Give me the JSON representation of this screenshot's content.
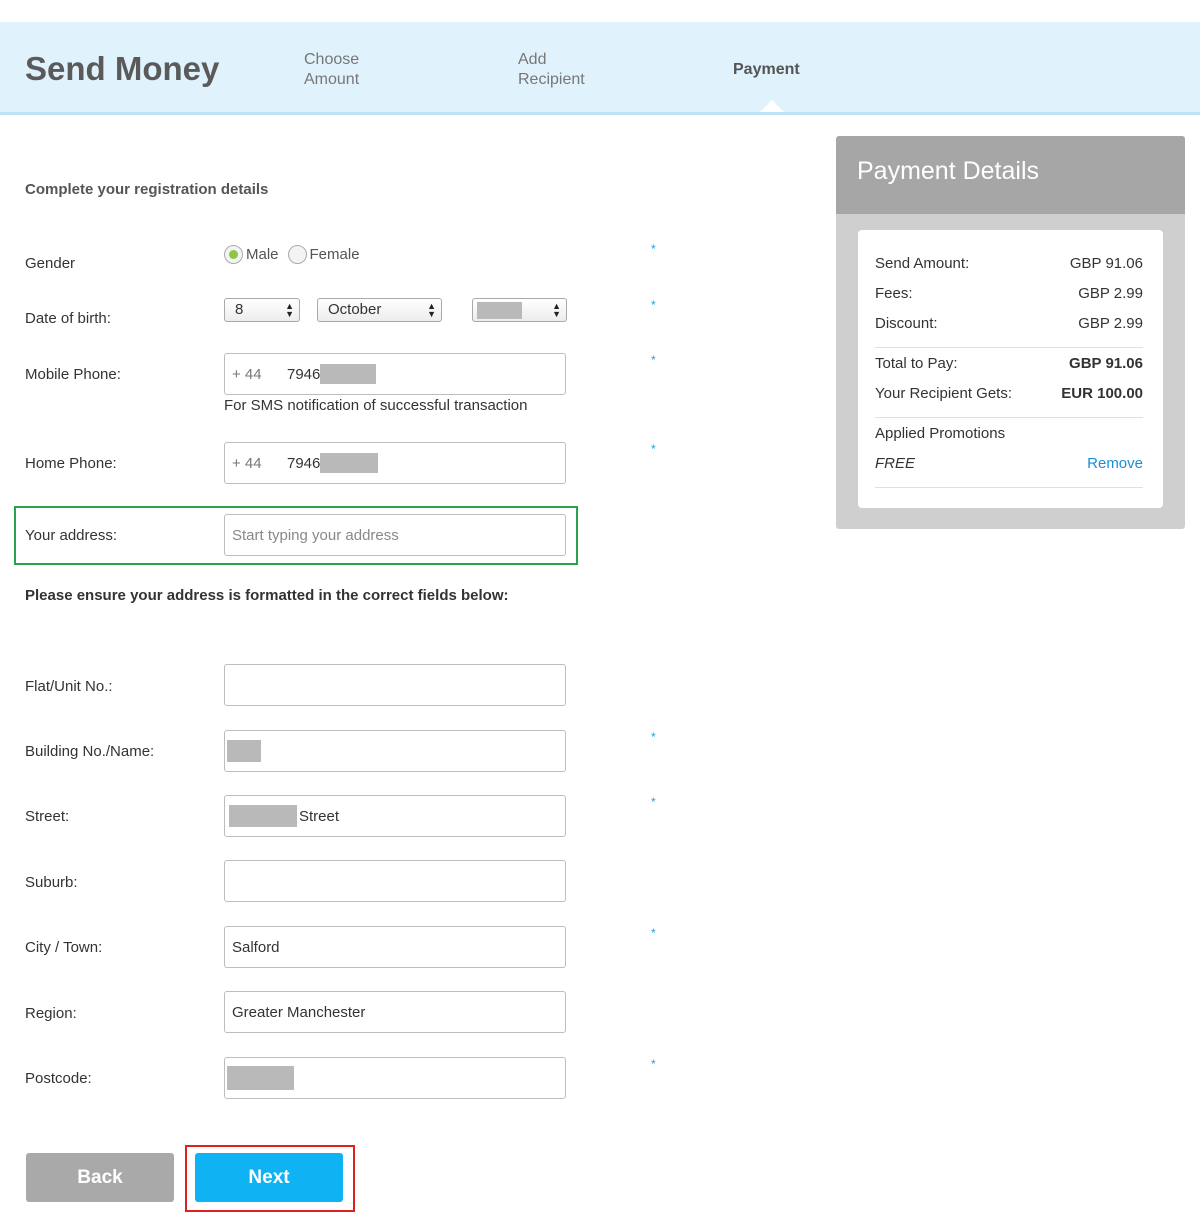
{
  "header": {
    "brand": "Send Money",
    "steps": [
      {
        "line1": "Choose",
        "line2": "Amount",
        "active": false
      },
      {
        "line1": "Add",
        "line2": "Recipient",
        "active": false
      },
      {
        "line1": "Payment",
        "line2": "",
        "active": true
      }
    ]
  },
  "form": {
    "section_title": "Complete your registration details",
    "gender": {
      "label": "Gender",
      "options": [
        "Male",
        "Female"
      ],
      "selected": "Male"
    },
    "dob": {
      "label": "Date of birth:",
      "day": "8",
      "month": "October",
      "year": ""
    },
    "mobile": {
      "label": "Mobile Phone:",
      "prefix": "+ 44",
      "value": "7946",
      "note": "For SMS notification of successful transaction"
    },
    "home": {
      "label": "Home Phone:",
      "prefix": "+ 44",
      "value": "7946"
    },
    "address": {
      "label": "Your address:",
      "placeholder": "Start typing your address"
    },
    "address_note": "Please ensure your address is formatted in the correct fields below:",
    "flat": {
      "label": "Flat/Unit No.:",
      "value": ""
    },
    "building": {
      "label": "Building No./Name:",
      "value": ""
    },
    "street": {
      "label": "Street:",
      "value": "Street"
    },
    "suburb": {
      "label": "Suburb:",
      "value": ""
    },
    "city": {
      "label": "City / Town:",
      "value": "Salford"
    },
    "region": {
      "label": "Region:",
      "value": "Greater Manchester"
    },
    "postcode": {
      "label": "Postcode:",
      "value": ""
    },
    "required_mark": "*"
  },
  "buttons": {
    "back": "Back",
    "next": "Next"
  },
  "payment": {
    "title": "Payment Details",
    "send_amount": {
      "label": "Send Amount:",
      "value": "GBP 91.06"
    },
    "fees": {
      "label": "Fees:",
      "value": "GBP 2.99"
    },
    "discount": {
      "label": "Discount:",
      "value": "GBP 2.99"
    },
    "total": {
      "label": "Total to Pay:",
      "value": "GBP 91.06"
    },
    "recipient_gets": {
      "label": "Your Recipient Gets:",
      "value": "EUR 100.00"
    },
    "promotions_label": "Applied Promotions",
    "promo_name": "FREE",
    "remove_label": "Remove"
  },
  "colors": {
    "header_bg": "#e0f2fc",
    "primary_button": "#0fb2f2",
    "secondary_button": "#a9a9a9",
    "radio_selected": "#8dc63f",
    "required_mark": "#1ba2e6",
    "highlight_address": "#2aa34a",
    "highlight_next": "#e02020"
  }
}
